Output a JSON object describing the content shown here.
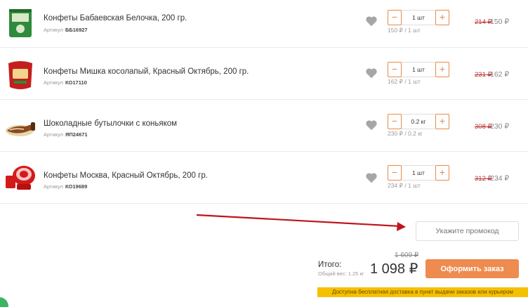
{
  "items": [
    {
      "name": "Конфеты Бабаевская Белочка, 200 гр.",
      "sku_label": "Артикул",
      "sku": "ББ16927",
      "quantity": "1 шт",
      "unit_price": "150 ₽  / 1 шт",
      "old_price": "214 ₽",
      "price": "150 ₽",
      "thumb_colors": [
        "#2f8a3b",
        "#d9e8c9"
      ]
    },
    {
      "name": "Конфеты Мишка косолапый, Красный Октябрь, 200 гр.",
      "sku_label": "Артикул",
      "sku": "КО17110",
      "quantity": "1 шт",
      "unit_price": "162 ₽  / 1 шт",
      "old_price": "231 ₽",
      "price": "162 ₽",
      "thumb_colors": [
        "#c41e1e",
        "#f2d58a"
      ]
    },
    {
      "name": "Шоколадные бутылочки с коньяком",
      "sku_label": "Артикул",
      "sku": "ЯП24671",
      "quantity": "0.2 кг",
      "unit_price": "230 ₽  / 0.2 кг",
      "old_price": "308 ₽",
      "price": "230 ₽",
      "thumb_colors": [
        "#8a4a1c",
        "#f3e2c4"
      ]
    },
    {
      "name": "Конфеты Москва, Красный Октябрь, 200 гр.",
      "sku_label": "Артикул",
      "sku": "КО19689",
      "quantity": "1 шт",
      "unit_price": "234 ₽  / 1 шт",
      "old_price": "312 ₽",
      "price": "234 ₽",
      "thumb_colors": [
        "#d31a1a",
        "#f6c2c2"
      ]
    }
  ],
  "promo": {
    "placeholder": "Укажите промокод"
  },
  "summary": {
    "total_label": "Итого:",
    "weight": "Общий вес: 1.25 кг",
    "old_total": "1 609 ₽",
    "total": "1 098 ₽",
    "checkout_label": "Оформить заказ"
  },
  "delivery_note": "Доступна бесплатная доставка в пункт выдачи заказов или курьером",
  "colors": {
    "accent": "#ee8b4e",
    "arrow": "#c0151b",
    "delivery_bg": "#f5c000",
    "heart": "#a6a6a6"
  },
  "icons": {
    "heart": "heart-icon",
    "minus": "minus-icon",
    "plus": "plus-icon"
  },
  "stepper": {
    "minus": "−",
    "plus": "+"
  }
}
